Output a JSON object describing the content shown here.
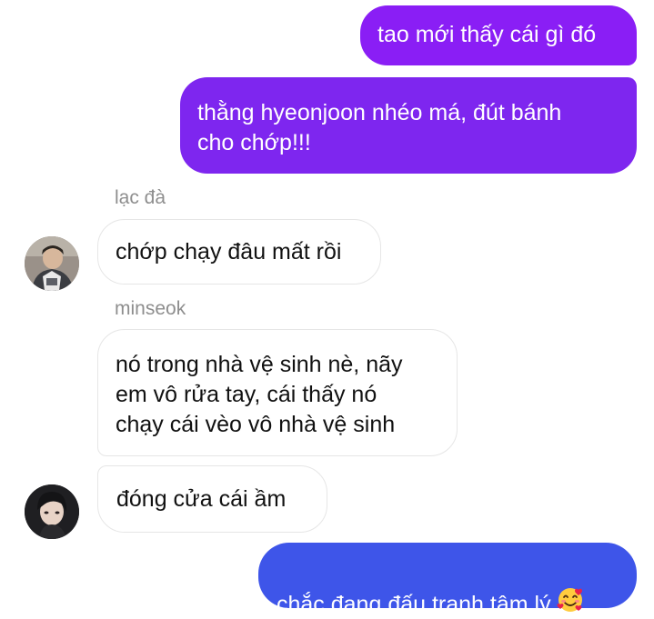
{
  "messages": {
    "out_1": "tao mới thấy cái gì đó",
    "out_2": "thằng hyeonjoon nhéo má, đút bánh\ncho chớp!!!",
    "in_1_sender": "lạc đà",
    "in_1": "chớp chạy đâu mất rồi",
    "in_2_sender": "minseok",
    "in_2": "nó trong nhà vệ sinh nè, nãy\nem vô rửa tay, cái thấy nó\nchạy cái vèo vô nhà vệ sinh",
    "in_3": "đóng cửa cái ầm",
    "out_3": "chắc đang đấu tranh tâm lý"
  },
  "icons": {
    "avatar_1": "avatar-photo-lac-da",
    "avatar_2": "avatar-photo-minseok",
    "emoji": "smiling-face-with-hearts-emoji"
  },
  "colors": {
    "outgoing_top": "#8a1ef5",
    "outgoing_mid": "#7e26ef",
    "outgoing_bottom": "#3e55e9",
    "incoming_border": "#e6e6e6",
    "sender_name": "#8e8e8e"
  }
}
